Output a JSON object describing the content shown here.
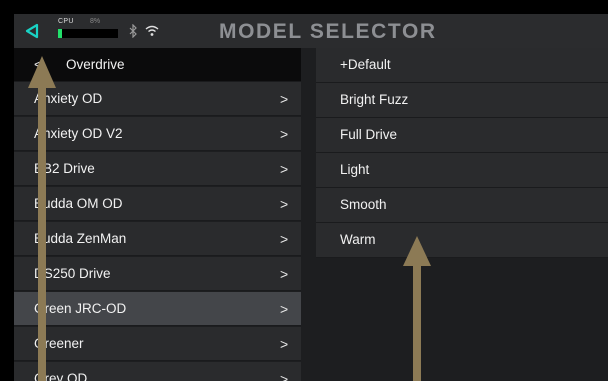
{
  "header": {
    "title": "MODEL SELECTOR",
    "cpu_label": "CPU",
    "cpu_percent": "8%",
    "cpu_load": 0.06,
    "icons": [
      "back-triangle-icon",
      "bluetooth-icon",
      "wifi-icon"
    ]
  },
  "left": {
    "category": "Overdrive",
    "items": [
      {
        "label": "Anxiety OD"
      },
      {
        "label": "Anxiety OD V2"
      },
      {
        "label": "BB2 Drive"
      },
      {
        "label": "Budda OM OD"
      },
      {
        "label": "Budda ZenMan"
      },
      {
        "label": "DS250 Drive"
      },
      {
        "label": "Green JRC-OD"
      },
      {
        "label": "Greener"
      },
      {
        "label": "Grey OD"
      }
    ],
    "selected_index": 6
  },
  "right": {
    "presets": [
      "+Default",
      "Bright Fuzz",
      "Full Drive",
      "Light",
      "Smooth",
      "Warm"
    ]
  },
  "colors": {
    "accent": "#19d3c5",
    "cpu_fill": "#22e06b",
    "arrow": "#8c7a55"
  }
}
